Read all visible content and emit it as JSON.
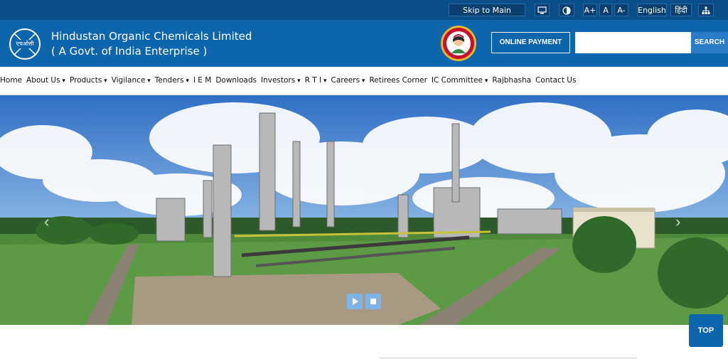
{
  "topbar": {
    "skip_label": "Skip to Main Content",
    "font_large": "A+",
    "font_normal": "A",
    "font_small": "A-",
    "lang_en": "English",
    "lang_hi": "हिंदी",
    "icons": [
      "screen-reader-icon",
      "contrast-icon",
      "sitemap-icon"
    ]
  },
  "header": {
    "logo_text": "एचओसी",
    "org_name": "Hindustan Organic Chemicals Limited",
    "org_sub": "( A Govt. of India Enterprise )",
    "pay_label": "ONLINE PAYMENT",
    "search_placeholder": "",
    "search_label": "SEARCH"
  },
  "nav": {
    "items": [
      {
        "label": "Home",
        "caret": false
      },
      {
        "label": "About Us",
        "caret": true
      },
      {
        "label": "Products",
        "caret": true
      },
      {
        "label": "Vigilance",
        "caret": true
      },
      {
        "label": "Tenders",
        "caret": true
      },
      {
        "label": "I E M",
        "caret": false
      },
      {
        "label": "Downloads",
        "caret": false
      },
      {
        "label": "Investors",
        "caret": true
      },
      {
        "label": "R T I",
        "caret": true
      },
      {
        "label": "Careers",
        "caret": true
      },
      {
        "label": "Retirees Corner",
        "caret": false
      },
      {
        "label": "IC Committee",
        "caret": true
      },
      {
        "label": "Rajbhasha",
        "caret": false
      },
      {
        "label": "Contact Us",
        "caret": false
      }
    ]
  },
  "hero": {
    "left_arrow": "‹",
    "right_arrow": "›"
  },
  "top_label": "TOP",
  "colors": {
    "topbar": "#0b4f8a",
    "header": "#0d66ab",
    "accent": "#2a7cc7"
  }
}
